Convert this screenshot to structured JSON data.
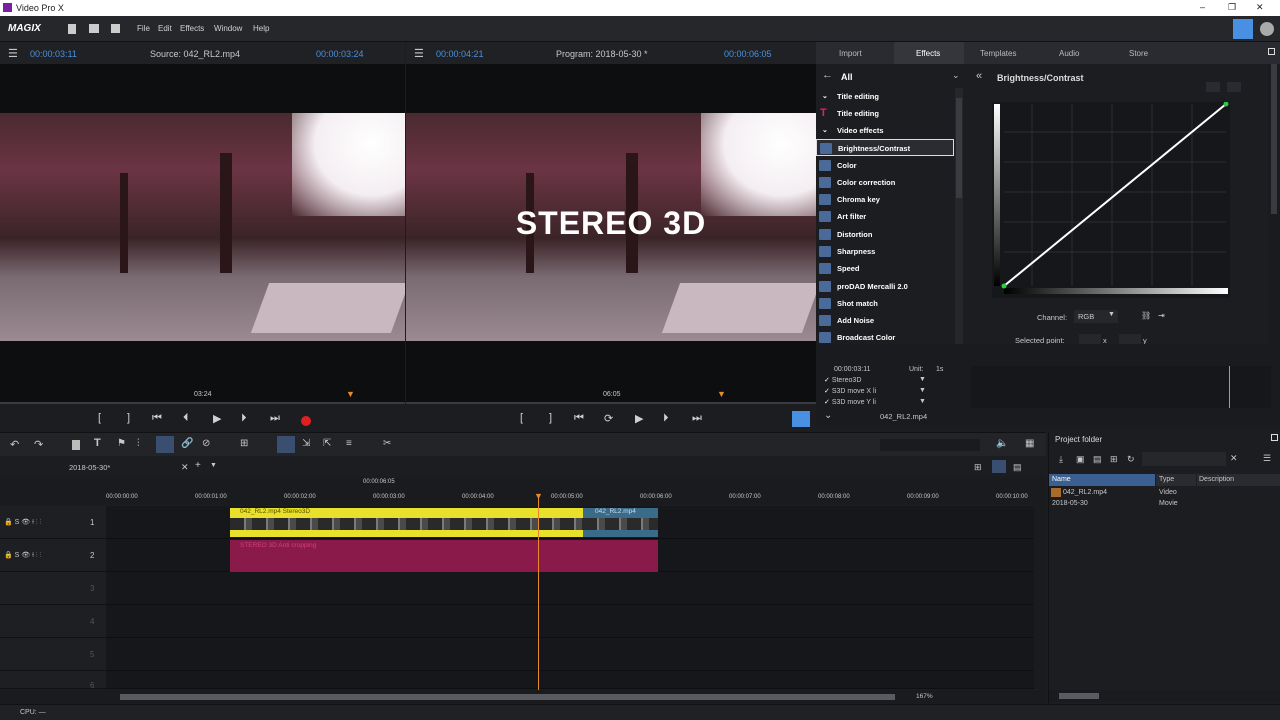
{
  "window": {
    "title": "Video Pro X",
    "controls": [
      "–",
      "❐",
      "✕"
    ]
  },
  "menubar": {
    "logo": "MAGIX",
    "items": [
      "File",
      "Edit",
      "Effects",
      "Window",
      "Help"
    ]
  },
  "source_monitor": {
    "timecode_left": "00:00:03:11",
    "title": "Source: 042_RL2.mp4",
    "timecode_right": "00:00:03:24",
    "scrub_label": "03:24"
  },
  "program_monitor": {
    "timecode_left": "00:00:04:21",
    "title": "Program: 2018-05-30 *",
    "timecode_right": "00:00:06:05",
    "overlay_text": "STEREO 3D",
    "scrub_label": "06:05"
  },
  "effects_tabs": [
    "Import",
    "Effects",
    "Templates",
    "Audio",
    "Store"
  ],
  "effects_panel": {
    "category": "All",
    "items": [
      {
        "label": "Title editing",
        "type": "header"
      },
      {
        "label": "Title editing",
        "type": "item",
        "icon": "title-icon"
      },
      {
        "label": "Video effects",
        "type": "header"
      },
      {
        "label": "Brightness/Contrast",
        "type": "selected"
      },
      {
        "label": "Color",
        "type": "item"
      },
      {
        "label": "Color correction",
        "type": "item"
      },
      {
        "label": "Chroma key",
        "type": "item"
      },
      {
        "label": "Art filter",
        "type": "item"
      },
      {
        "label": "Distortion",
        "type": "item"
      },
      {
        "label": "Sharpness",
        "type": "item"
      },
      {
        "label": "Speed",
        "type": "item"
      },
      {
        "label": "proDAD Mercalli 2.0",
        "type": "item"
      },
      {
        "label": "Shot match",
        "type": "item"
      },
      {
        "label": "Add Noise",
        "type": "item"
      },
      {
        "label": "Broadcast Color",
        "type": "item"
      }
    ],
    "detail_title": "Brightness/Contrast",
    "channel_label": "Channel:",
    "channel_value": "RGB",
    "selected_point_label": "Selected point:",
    "selected_point_x": "x",
    "selected_point_y": "y"
  },
  "keyframes": {
    "timecode": "00:00:03:11",
    "unit_label": "Unit:",
    "unit_value": "1s",
    "tracks": [
      "Stereo3D",
      "S3D move X li",
      "S3D move Y li"
    ],
    "file": "042_RL2.mp4"
  },
  "timeline": {
    "tab": "2018-05-30*",
    "playhead_label": "00:00:06:05",
    "ruler": [
      "00:00:00:00",
      "00:00:01:00",
      "00:00:02:00",
      "00:00:03:00",
      "00:00:04:00",
      "00:00:05:00",
      "00:00:06:00",
      "00:00:07:00",
      "00:00:08:00",
      "00:00:09:00",
      "00:00:10:00"
    ],
    "tracks": [
      "1",
      "2",
      "3",
      "4",
      "5",
      "6"
    ],
    "clip1_label": "042_RL2.mp4   Stereo3D",
    "clip1b_label": "042_RL2.mp4",
    "clip2_label": "STEREO 3D   Anti cropping",
    "zoom": "167%"
  },
  "project_folder": {
    "title": "Project folder",
    "columns": [
      "Name",
      "Type",
      "Description"
    ],
    "rows": [
      {
        "name": "042_RL2.mp4",
        "type": "Video",
        "description": ""
      },
      {
        "name": "2018-05-30",
        "type": "Movie",
        "description": ""
      }
    ]
  },
  "status": {
    "cpu": "CPU: —"
  },
  "colors": {
    "accent": "#4a90e2",
    "clip_yellow": "#e8e02a",
    "clip_magenta": "#8a1a4a",
    "playhead": "#e8892a"
  }
}
